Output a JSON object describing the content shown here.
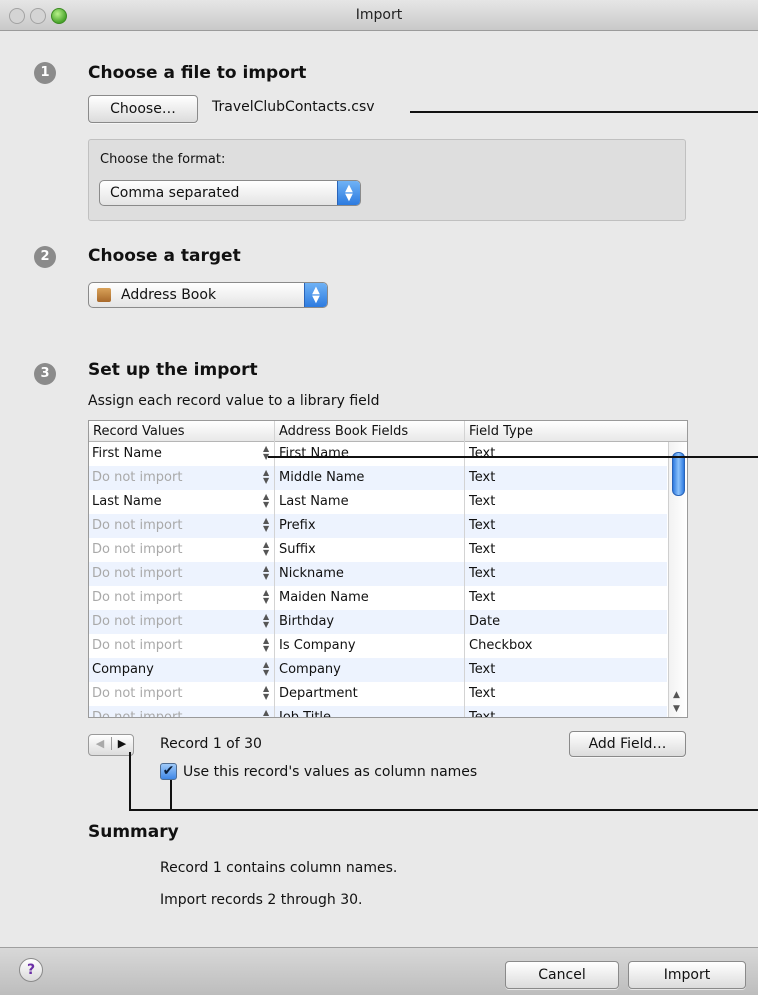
{
  "window": {
    "title": "Import"
  },
  "step1": {
    "number": "1",
    "heading": "Choose a file to import",
    "choose_button": "Choose…",
    "filename": "TravelClubContacts.csv",
    "format_label": "Choose the format:",
    "format_value": "Comma separated"
  },
  "step2": {
    "number": "2",
    "heading": "Choose a target",
    "target_value": "Address Book"
  },
  "step3": {
    "number": "3",
    "heading": "Set up the import",
    "instruction": "Assign each record value to a library field",
    "table": {
      "columns": [
        "Record Values",
        "Address Book Fields",
        "Field Type"
      ],
      "rows": [
        {
          "record": "First Name",
          "field": "First Name",
          "type": "Text",
          "import": true
        },
        {
          "record": "Do not import",
          "field": "Middle Name",
          "type": "Text",
          "import": false
        },
        {
          "record": "Last Name",
          "field": "Last Name",
          "type": "Text",
          "import": true
        },
        {
          "record": "Do not import",
          "field": "Prefix",
          "type": "Text",
          "import": false
        },
        {
          "record": "Do not import",
          "field": "Suffix",
          "type": "Text",
          "import": false
        },
        {
          "record": "Do not import",
          "field": "Nickname",
          "type": "Text",
          "import": false
        },
        {
          "record": "Do not import",
          "field": "Maiden Name",
          "type": "Text",
          "import": false
        },
        {
          "record": "Do not import",
          "field": "Birthday",
          "type": "Date",
          "import": false
        },
        {
          "record": "Do not import",
          "field": "Is Company",
          "type": "Checkbox",
          "import": false
        },
        {
          "record": "Company",
          "field": "Company",
          "type": "Text",
          "import": true
        },
        {
          "record": "Do not import",
          "field": "Department",
          "type": "Text",
          "import": false
        },
        {
          "record": "Do not import",
          "field": "Job Title",
          "type": "Text",
          "import": false
        }
      ]
    },
    "record_label": "Record 1 of 30",
    "add_field_button": "Add Field…",
    "column_names_checkbox": "Use this record's values as column names",
    "column_names_checked": true
  },
  "summary": {
    "heading": "Summary",
    "line1": "Record 1 contains column names.",
    "line2": "Import records 2 through 30."
  },
  "footer": {
    "help": "?",
    "cancel_button": "Cancel",
    "import_button": "Import"
  },
  "colors": {
    "accent": "#3f87e6",
    "alt_row": "#edf3fe",
    "dim_text": "#a9a9a9"
  }
}
